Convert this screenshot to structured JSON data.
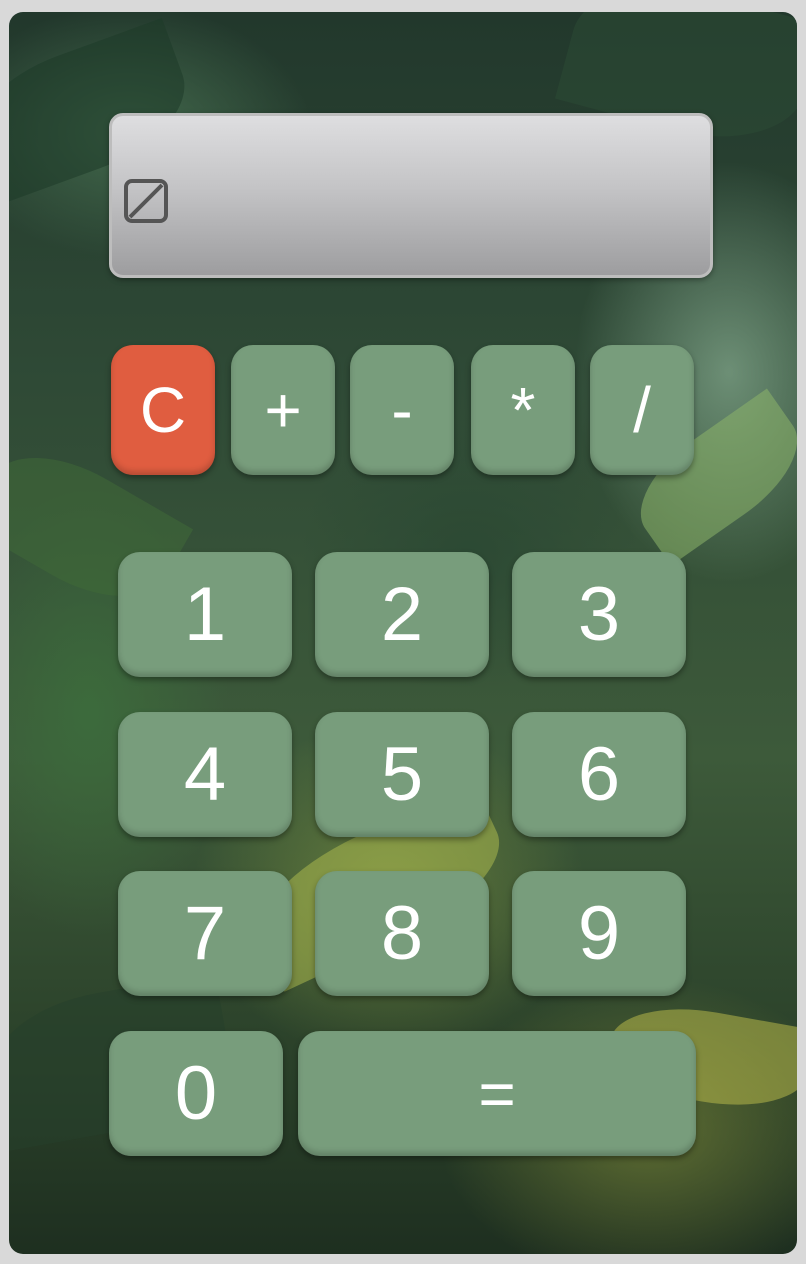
{
  "display": {
    "value": "",
    "broken_image_icon": "broken-image-icon"
  },
  "operators": {
    "clear": "C",
    "plus": "+",
    "minus": "-",
    "multiply": "*",
    "divide": "/"
  },
  "digits": {
    "one": "1",
    "two": "2",
    "three": "3",
    "four": "4",
    "five": "5",
    "six": "6",
    "seven": "7",
    "eight": "8",
    "nine": "9",
    "zero": "0"
  },
  "equals": "=",
  "colors": {
    "button": "#789d7c",
    "clear_button": "#e05d40",
    "button_text": "#ffffff"
  }
}
